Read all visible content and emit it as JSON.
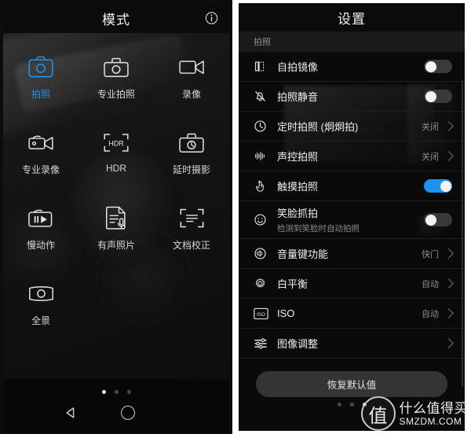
{
  "left_panel": {
    "header": {
      "title": "模式",
      "info_icon": "info-circle-icon"
    },
    "modes": [
      {
        "label": "拍照",
        "icon": "photo-camera-icon",
        "active": true
      },
      {
        "label": "专业拍照",
        "icon": "pro-photo-camera-icon",
        "active": false
      },
      {
        "label": "录像",
        "icon": "video-camera-icon",
        "active": false
      },
      {
        "label": "专业录像",
        "icon": "pro-video-camera-icon",
        "active": false
      },
      {
        "label": "HDR",
        "icon": "hdr-bracket-icon",
        "active": false
      },
      {
        "label": "延时摄影",
        "icon": "timelapse-camera-icon",
        "active": false
      },
      {
        "label": "慢动作",
        "icon": "slow-motion-camera-icon",
        "active": false
      },
      {
        "label": "有声照片",
        "icon": "audio-photo-icon",
        "active": false
      },
      {
        "label": "文档校正",
        "icon": "document-correction-icon",
        "active": false
      },
      {
        "label": "全景",
        "icon": "panorama-icon",
        "active": false
      }
    ],
    "page_dots": {
      "count": 3,
      "active_index": 0
    },
    "navbar": {
      "back_icon": "back-triangle-icon",
      "home_icon": "home-circle-icon"
    }
  },
  "right_panel": {
    "header": {
      "title": "设置"
    },
    "section_label": "拍照",
    "settings": [
      {
        "label": "自拍镜像",
        "icon": "mirror-selfie-icon",
        "control": "toggle",
        "state": "off"
      },
      {
        "label": "拍照静音",
        "icon": "mute-bell-icon",
        "control": "toggle",
        "state": "off"
      },
      {
        "label": "定时拍照 (炯炯拍)",
        "icon": "clock-icon",
        "control": "chevron",
        "value": "关闭"
      },
      {
        "label": "声控拍照",
        "icon": "sound-wave-icon",
        "control": "chevron",
        "value": "关闭"
      },
      {
        "label": "触摸拍照",
        "icon": "touch-hand-icon",
        "control": "toggle",
        "state": "on"
      },
      {
        "label": "笑脸抓拍",
        "sublabel": "检测到笑脸时自动拍照",
        "icon": "smiley-face-icon",
        "control": "toggle",
        "state": "off"
      },
      {
        "label": "音量键功能",
        "icon": "volume-speaker-icon",
        "control": "chevron",
        "value": "快门"
      },
      {
        "label": "白平衡",
        "icon": "white-balance-sun-icon",
        "control": "chevron",
        "value": "自动"
      },
      {
        "label": "ISO",
        "icon": "iso-box-icon",
        "control": "chevron",
        "value": "自动"
      },
      {
        "label": "图像调整",
        "icon": "sliders-icon",
        "control": "chevron",
        "value": ""
      }
    ],
    "reset_button": "恢复默认值",
    "page_dots": {
      "count": 3,
      "active_index": 2
    }
  },
  "watermark": {
    "seal_glyph": "值",
    "cn_text": "什么值得买",
    "en_text": "SMZDM.COM"
  },
  "colors": {
    "accent_blue": "#1b93f0",
    "panel_bg": "#0a0a0a",
    "text_primary": "#efefef",
    "text_secondary": "#8e8e8e"
  }
}
